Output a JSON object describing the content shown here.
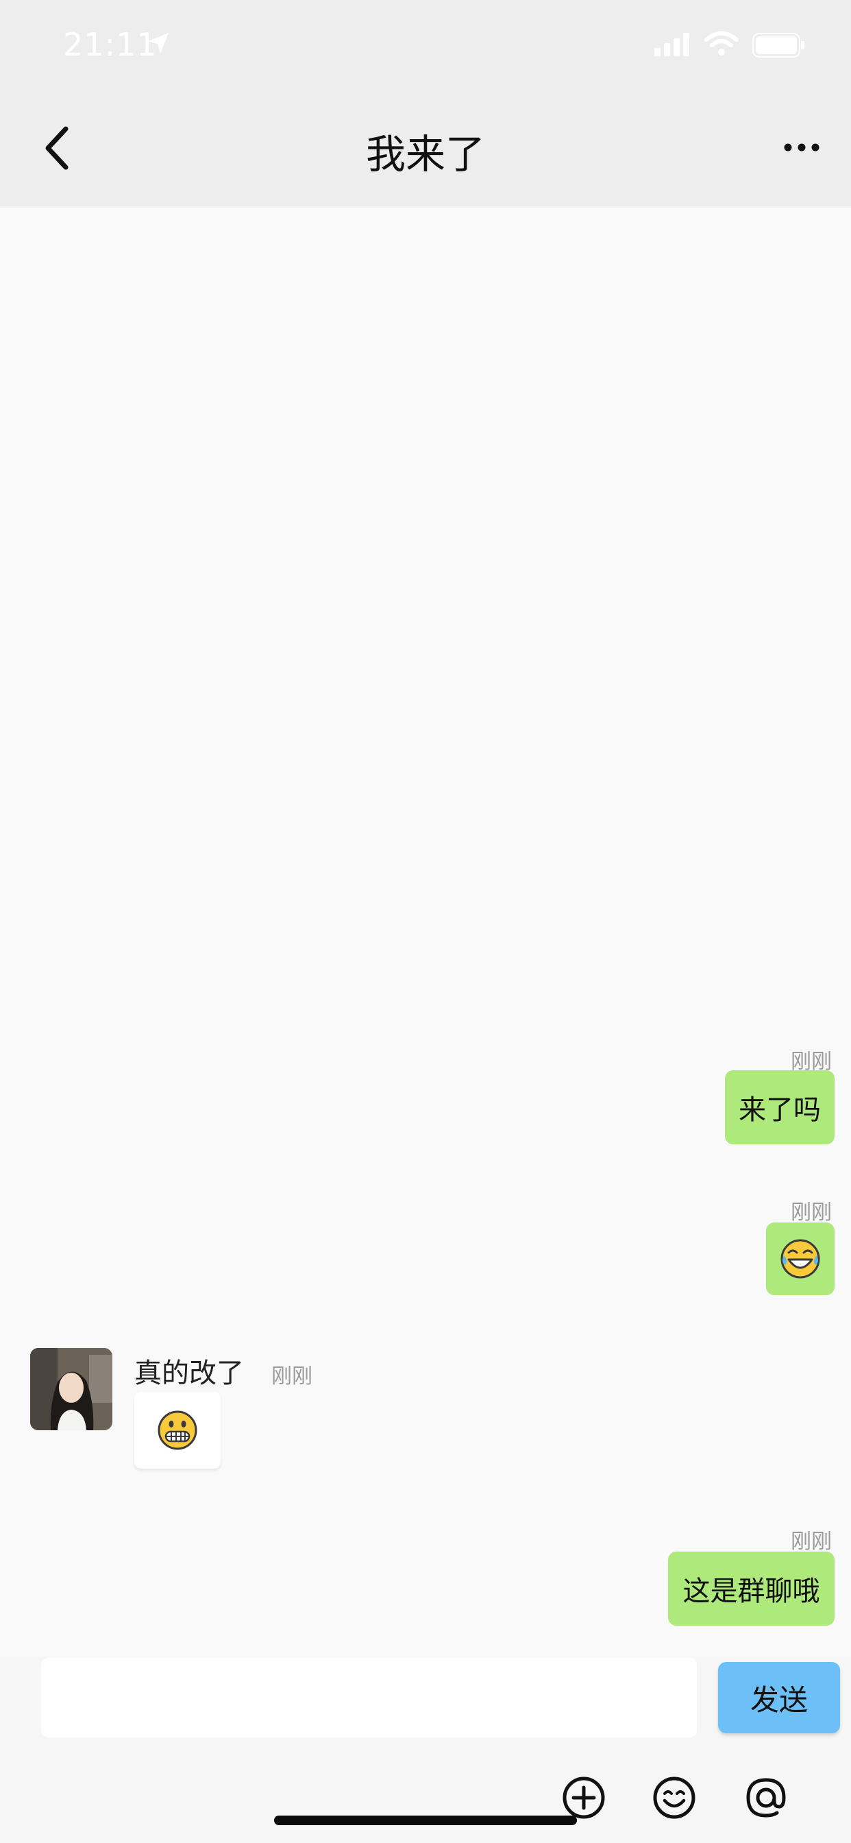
{
  "status_bar": {
    "time": "21:11",
    "icons": [
      "location-arrow-icon",
      "signal-icon",
      "wifi-icon",
      "battery-icon"
    ]
  },
  "nav": {
    "title": "我来了",
    "back_icon": "chevron-left-icon",
    "more_icon": "more-dots-icon"
  },
  "messages": [
    {
      "side": "right",
      "time": "刚刚",
      "text": "来了吗"
    },
    {
      "side": "right",
      "time": "刚刚",
      "emoji": "😂"
    },
    {
      "side": "left",
      "sender": "真的改了",
      "time": "刚刚",
      "emoji": "😁"
    },
    {
      "side": "right",
      "time": "刚刚",
      "text": "这是群聊哦"
    }
  ],
  "composer": {
    "input_value": "",
    "send_label": "发送",
    "tool_icons": [
      "plus-circle-icon",
      "emoji-icon",
      "at-mention-icon"
    ]
  },
  "colors": {
    "bubble_right": "#aee97b",
    "send_button": "#6cc0f7",
    "header_bg": "#ededed"
  }
}
